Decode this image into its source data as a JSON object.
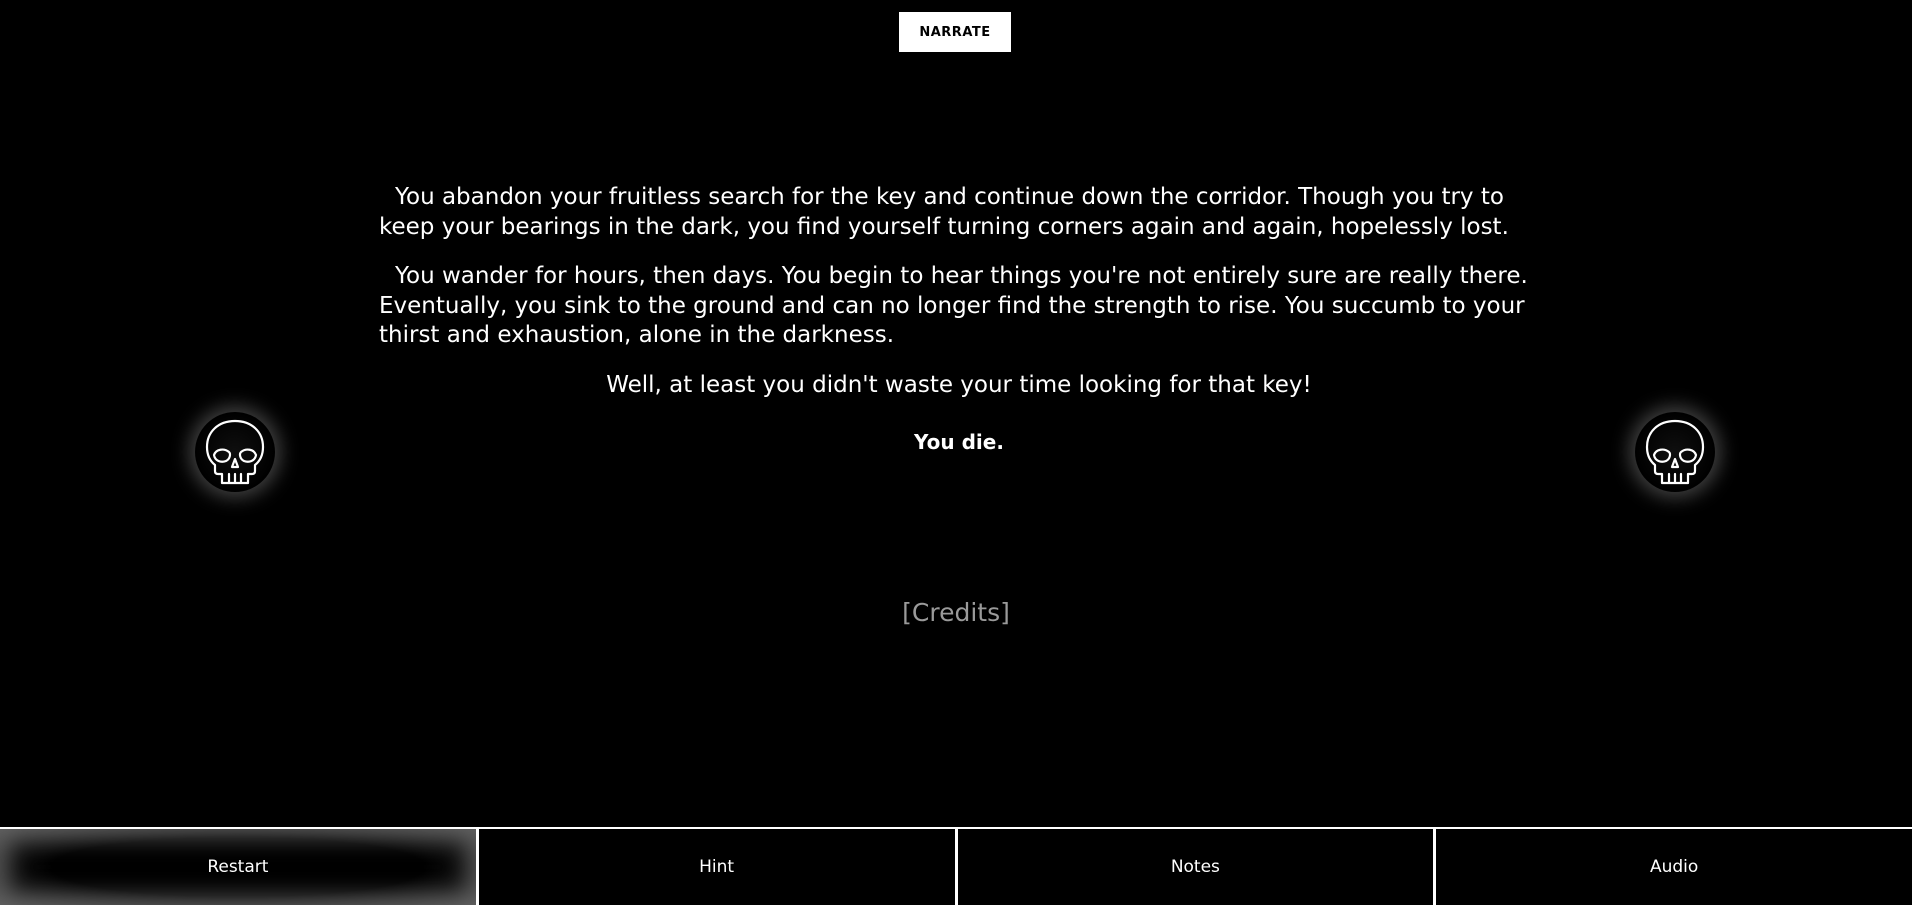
{
  "toolbar": {
    "narrate_label": "NARRATE"
  },
  "story": {
    "paragraph1": "You abandon your fruitless search for the key and continue down the corridor. Though you try to keep your bearings in the dark, you find yourself turning corners again and again, hopelessly lost.",
    "paragraph2": "You wander for hours, then days. You begin to hear things you're not entirely sure are really there. Eventually, you sink to the ground and can no longer find the strength to rise. You succumb to your thirst and exhaustion, alone in the darkness.",
    "quip": "Well, at least you didn't waste your time looking for that key!",
    "outcome": "You die."
  },
  "credits_link": "[Credits]",
  "icons": {
    "left": "skull-icon",
    "right": "skull-icon"
  },
  "bottom_bar": {
    "restart": "Restart",
    "hint": "Hint",
    "notes": "Notes",
    "audio": "Audio"
  }
}
